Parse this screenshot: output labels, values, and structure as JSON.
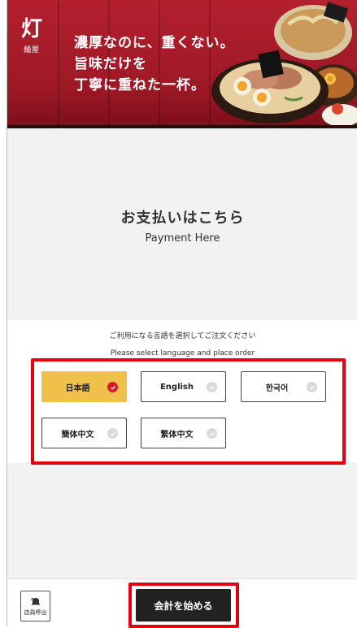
{
  "banner": {
    "brand_kanji": "灯",
    "brand_sub": "麺屋",
    "catch_lines": [
      "濃厚なのに、重くない。",
      "旨味だけを",
      "丁寧に重ねた一杯。"
    ]
  },
  "payment": {
    "title_jp": "お支払いはこちら",
    "title_en": "Payment Here"
  },
  "language": {
    "prompt_jp": "ご利用になる言語を選択してご注文ください",
    "prompt_en": "Please select language and place order",
    "options": [
      {
        "label": "日本語",
        "selected": true
      },
      {
        "label": "English",
        "selected": false
      },
      {
        "label": "한국어",
        "selected": false
      },
      {
        "label": "簡体中文",
        "selected": false
      },
      {
        "label": "繁体中文",
        "selected": false
      }
    ]
  },
  "bottom_bar": {
    "call_staff_label": "店員呼出",
    "checkout_label": "会計を始める"
  },
  "colors": {
    "banner_red": "#b3202e",
    "selected_yellow": "#efc14a",
    "check_red": "#d81b2c",
    "highlight_red": "#e3000f",
    "checkout_black": "#222222"
  },
  "icons": [
    "bowl-illustration",
    "check-icon",
    "bell-icon"
  ]
}
